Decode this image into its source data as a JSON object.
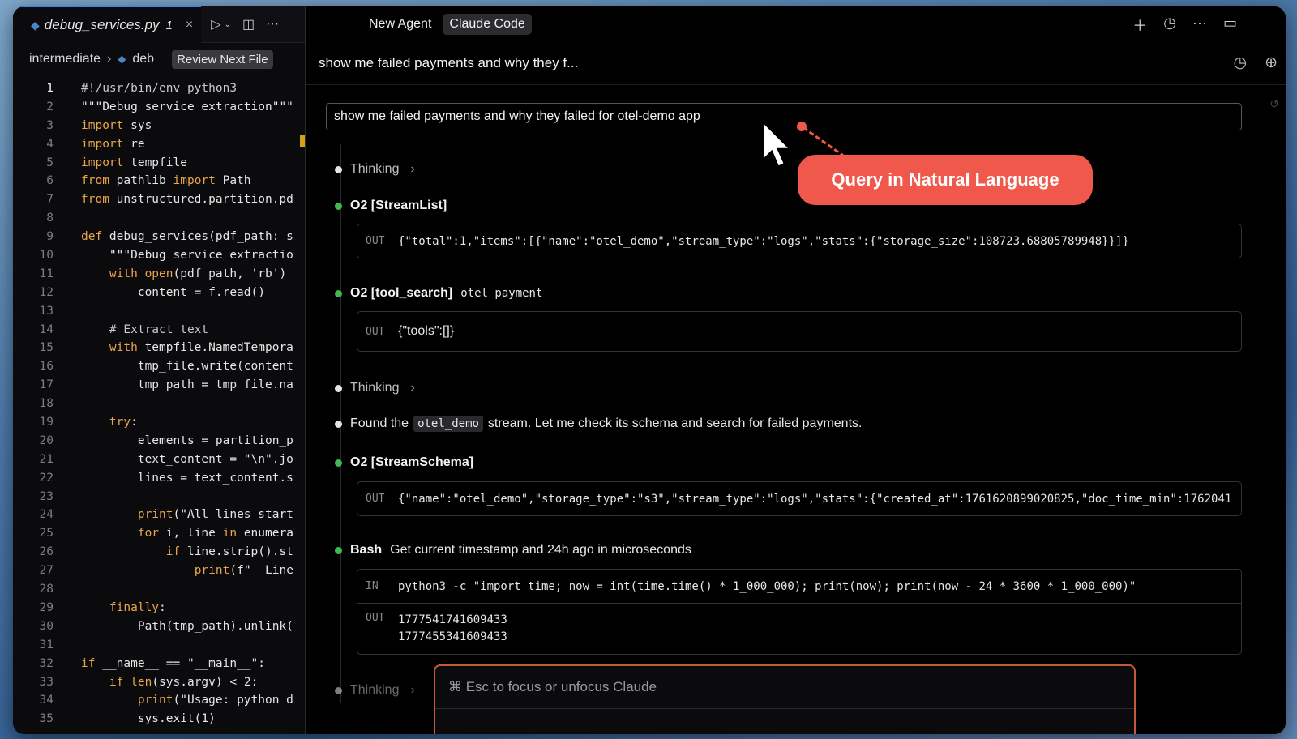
{
  "editor": {
    "tab": {
      "filename": "debug_services.py",
      "badge": "1",
      "close": "×"
    },
    "breadcrumbs": {
      "folder": "intermediate",
      "file": "deb",
      "review_button": "Review Next File"
    },
    "lines": [
      {
        "n": "1",
        "t": "#!/usr/bin/env python3"
      },
      {
        "n": "2",
        "t": "\"\"\"Debug service extraction\"\"\""
      },
      {
        "n": "3",
        "t": "import sys"
      },
      {
        "n": "4",
        "t": "import re"
      },
      {
        "n": "5",
        "t": "import tempfile"
      },
      {
        "n": "6",
        "t": "from pathlib import Path"
      },
      {
        "n": "7",
        "t": "from unstructured.partition.pd"
      },
      {
        "n": "8",
        "t": ""
      },
      {
        "n": "9",
        "t": "def debug_services(pdf_path: s"
      },
      {
        "n": "10",
        "t": "    \"\"\"Debug service extractio"
      },
      {
        "n": "11",
        "t": "    with open(pdf_path, 'rb')"
      },
      {
        "n": "12",
        "t": "        content = f.read()"
      },
      {
        "n": "13",
        "t": ""
      },
      {
        "n": "14",
        "t": "    # Extract text"
      },
      {
        "n": "15",
        "t": "    with tempfile.NamedTempora"
      },
      {
        "n": "16",
        "t": "        tmp_file.write(content"
      },
      {
        "n": "17",
        "t": "        tmp_path = tmp_file.na"
      },
      {
        "n": "18",
        "t": ""
      },
      {
        "n": "19",
        "t": "    try:"
      },
      {
        "n": "20",
        "t": "        elements = partition_p"
      },
      {
        "n": "21",
        "t": "        text_content = \"\\n\".jo"
      },
      {
        "n": "22",
        "t": "        lines = text_content.s"
      },
      {
        "n": "23",
        "t": ""
      },
      {
        "n": "24",
        "t": "        print(\"All lines start"
      },
      {
        "n": "25",
        "t": "        for i, line in enumera"
      },
      {
        "n": "26",
        "t": "            if line.strip().st"
      },
      {
        "n": "27",
        "t": "                print(f\"  Line"
      },
      {
        "n": "28",
        "t": ""
      },
      {
        "n": "29",
        "t": "    finally:"
      },
      {
        "n": "30",
        "t": "        Path(tmp_path).unlink("
      },
      {
        "n": "31",
        "t": ""
      },
      {
        "n": "32",
        "t": "if __name__ == \"__main__\":"
      },
      {
        "n": "33",
        "t": "    if len(sys.argv) < 2:"
      },
      {
        "n": "34",
        "t": "        print(\"Usage: python d"
      },
      {
        "n": "35",
        "t": "        sys.exit(1)"
      }
    ]
  },
  "panel": {
    "tabs": [
      "New Agent",
      "Claude Code"
    ],
    "conversation_title": "show me failed payments and why they f...",
    "query": "show me failed payments and why they failed for otel-demo app",
    "callout": "Query in Natural Language",
    "steps": {
      "thinking1": "Thinking",
      "s1_title": "O2 [StreamList]",
      "s1_out_tag": "OUT",
      "s1_out": "{\"total\":1,\"items\":[{\"name\":\"otel_demo\",\"stream_type\":\"logs\",\"stats\":{\"storage_size\":108723.68805789948}}]}",
      "s2_title": "O2 [tool_search]",
      "s2_arg": "otel payment",
      "s2_out_tag": "OUT",
      "s2_out": "{\"tools\":[]}",
      "thinking2": "Thinking",
      "found_pre": "Found the",
      "found_code": "otel_demo",
      "found_post": "stream. Let me check its schema and search for failed payments.",
      "s3_title": "O2 [StreamSchema]",
      "s3_out_tag": "OUT",
      "s3_out": "{\"name\":\"otel_demo\",\"storage_type\":\"s3\",\"stream_type\":\"logs\",\"stats\":{\"created_at\":1761620899020825,\"doc_time_min\":1762041",
      "s4_title": "Bash",
      "s4_desc": "Get current timestamp and 24h ago in microseconds",
      "s4_in_tag": "IN",
      "s4_in": "python3 -c \"import time; now = int(time.time() * 1_000_000); print(now); print(now - 24 * 3600 * 1_000_000)\"",
      "s4_out_tag": "OUT",
      "s4_out1": "1777541741609433",
      "s4_out2": "1777455341609433",
      "thinking3": "Thinking"
    },
    "input_placeholder": "⌘ Esc to focus or unfocus Claude"
  }
}
